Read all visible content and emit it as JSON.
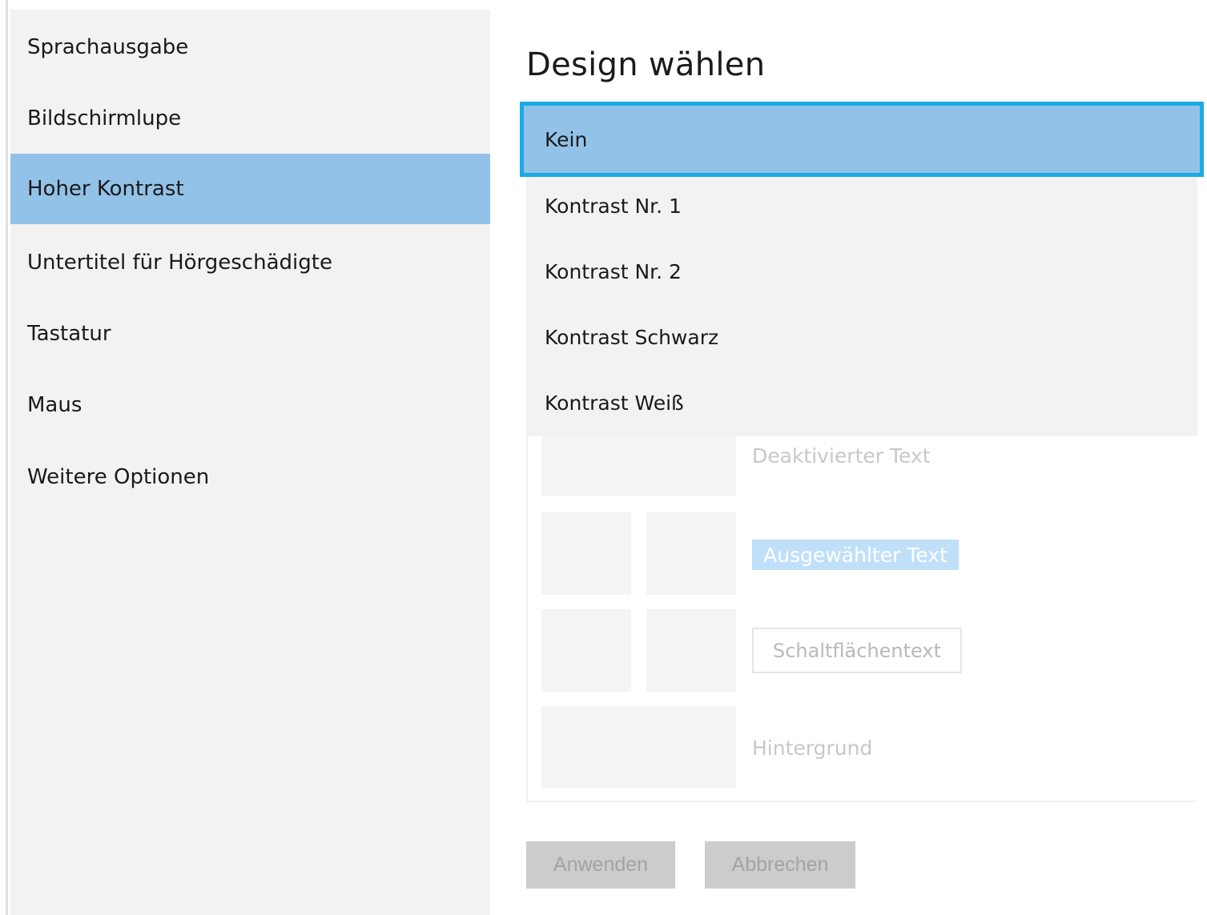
{
  "sidebar": {
    "items": [
      {
        "label": "Sprachausgabe"
      },
      {
        "label": "Bildschirmlupe"
      },
      {
        "label": "Hoher Kontrast"
      },
      {
        "label": "Untertitel für Hörgeschädigte"
      },
      {
        "label": "Tastatur"
      },
      {
        "label": "Maus"
      },
      {
        "label": "Weitere Optionen"
      }
    ],
    "selected": "Hoher Kontrast"
  },
  "main": {
    "title": "Design wählen",
    "themes": [
      {
        "label": "Kein"
      },
      {
        "label": "Kontrast Nr. 1"
      },
      {
        "label": "Kontrast Nr. 2"
      },
      {
        "label": "Kontrast Schwarz"
      },
      {
        "label": "Kontrast Weiß"
      }
    ],
    "selected_theme": "Kein",
    "preview": {
      "disabled_text": "Deaktivierter Text",
      "selected_text": "Ausgewählter Text",
      "button_text": "Schaltflächentext",
      "background_text": "Hintergrund"
    },
    "buttons": {
      "apply": "Anwenden",
      "cancel": "Abbrechen"
    }
  },
  "colors": {
    "accent": "#1aaae6",
    "selection": "#93c2e8",
    "sidebar_bg": "#f2f2f2"
  }
}
